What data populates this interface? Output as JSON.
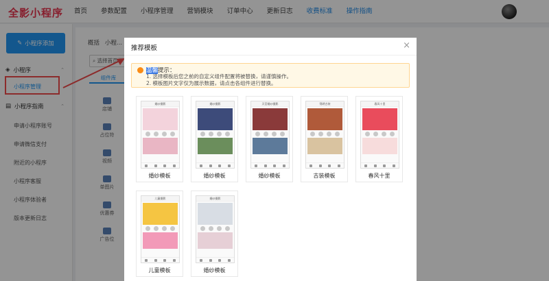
{
  "app": {
    "logo": "全影小程序"
  },
  "nav": [
    "首页",
    "参数配置",
    "小程序管理",
    "营销模块",
    "订单中心",
    "更新日志",
    "收费标准",
    "操作指南"
  ],
  "sidebar": {
    "add_button": "小程序添加",
    "group1": "小程序",
    "active_item": "小程序管理",
    "group2": "小程序指南",
    "items": [
      "申请小程序账号",
      "申请微信支付",
      "附近的小程序",
      "小程序客服",
      "小程序体验者",
      "版本更新日志"
    ]
  },
  "background": {
    "breadcrumb": [
      "概括",
      "小程..."
    ],
    "select_placeholder": "选择首页样",
    "tab": "组件库",
    "components": [
      "店铺",
      "占位符",
      "视频",
      "单图片",
      "优惠券",
      "广告位"
    ]
  },
  "modal": {
    "title": "推荐模板",
    "notice_title_highlight": "温馨",
    "notice_title_rest": "提示：",
    "notice_lines": [
      "1. 选择模板后您之前的自定义组件配置将被替换，请谨慎操作。",
      "2. 模板图片文字仅为展示数据，请点击各组件进行替换。"
    ],
    "templates": [
      {
        "label": "婚纱模板",
        "banner": "#f3d3dc",
        "block": "#e9b6c4",
        "bar": "婚纱摄影"
      },
      {
        "label": "婚纱模板",
        "banner": "#3d4b7a",
        "block": "#6b8e5c",
        "bar": "婚纱摄影"
      },
      {
        "label": "婚纱模板",
        "banner": "#8a3a3a",
        "block": "#5d7a9a",
        "bar": "天官婚纱摄影"
      },
      {
        "label": "古装模板",
        "banner": "#b05a3a",
        "block": "#d9c3a0",
        "bar": "锦绣古装"
      },
      {
        "label": "春风十里",
        "banner": "#e94c5c",
        "block": "#f7dcdc",
        "bar": "春风十里"
      },
      {
        "label": "儿童模板",
        "banner": "#f5c542",
        "block": "#f29ab8",
        "bar": "儿童摄影"
      },
      {
        "label": "婚纱模板",
        "banner": "#d8dde4",
        "block": "#e6cfd6",
        "bar": "婚纱摄影"
      }
    ],
    "close": "×"
  },
  "colors": {
    "accent": "#2196f3",
    "brand": "#e8344e",
    "highlight_nav": "#1e88e5",
    "warning": "#fa8c16",
    "annotation": "#f24b4b"
  }
}
